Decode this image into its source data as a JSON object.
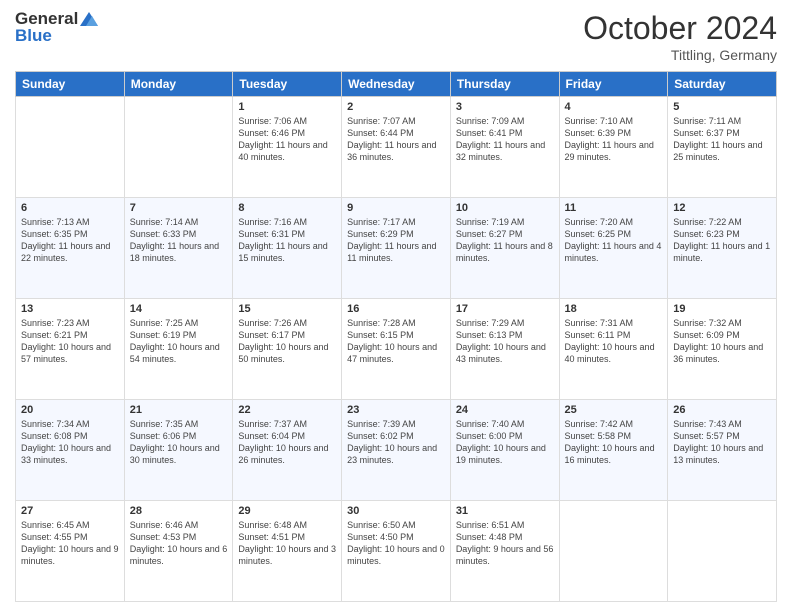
{
  "header": {
    "logo_line1": "General",
    "logo_line2": "Blue",
    "month": "October 2024",
    "location": "Tittling, Germany"
  },
  "weekdays": [
    "Sunday",
    "Monday",
    "Tuesday",
    "Wednesday",
    "Thursday",
    "Friday",
    "Saturday"
  ],
  "weeks": [
    [
      {
        "day": "",
        "sunrise": "",
        "sunset": "",
        "daylight": ""
      },
      {
        "day": "",
        "sunrise": "",
        "sunset": "",
        "daylight": ""
      },
      {
        "day": "1",
        "sunrise": "Sunrise: 7:06 AM",
        "sunset": "Sunset: 6:46 PM",
        "daylight": "Daylight: 11 hours and 40 minutes."
      },
      {
        "day": "2",
        "sunrise": "Sunrise: 7:07 AM",
        "sunset": "Sunset: 6:44 PM",
        "daylight": "Daylight: 11 hours and 36 minutes."
      },
      {
        "day": "3",
        "sunrise": "Sunrise: 7:09 AM",
        "sunset": "Sunset: 6:41 PM",
        "daylight": "Daylight: 11 hours and 32 minutes."
      },
      {
        "day": "4",
        "sunrise": "Sunrise: 7:10 AM",
        "sunset": "Sunset: 6:39 PM",
        "daylight": "Daylight: 11 hours and 29 minutes."
      },
      {
        "day": "5",
        "sunrise": "Sunrise: 7:11 AM",
        "sunset": "Sunset: 6:37 PM",
        "daylight": "Daylight: 11 hours and 25 minutes."
      }
    ],
    [
      {
        "day": "6",
        "sunrise": "Sunrise: 7:13 AM",
        "sunset": "Sunset: 6:35 PM",
        "daylight": "Daylight: 11 hours and 22 minutes."
      },
      {
        "day": "7",
        "sunrise": "Sunrise: 7:14 AM",
        "sunset": "Sunset: 6:33 PM",
        "daylight": "Daylight: 11 hours and 18 minutes."
      },
      {
        "day": "8",
        "sunrise": "Sunrise: 7:16 AM",
        "sunset": "Sunset: 6:31 PM",
        "daylight": "Daylight: 11 hours and 15 minutes."
      },
      {
        "day": "9",
        "sunrise": "Sunrise: 7:17 AM",
        "sunset": "Sunset: 6:29 PM",
        "daylight": "Daylight: 11 hours and 11 minutes."
      },
      {
        "day": "10",
        "sunrise": "Sunrise: 7:19 AM",
        "sunset": "Sunset: 6:27 PM",
        "daylight": "Daylight: 11 hours and 8 minutes."
      },
      {
        "day": "11",
        "sunrise": "Sunrise: 7:20 AM",
        "sunset": "Sunset: 6:25 PM",
        "daylight": "Daylight: 11 hours and 4 minutes."
      },
      {
        "day": "12",
        "sunrise": "Sunrise: 7:22 AM",
        "sunset": "Sunset: 6:23 PM",
        "daylight": "Daylight: 11 hours and 1 minute."
      }
    ],
    [
      {
        "day": "13",
        "sunrise": "Sunrise: 7:23 AM",
        "sunset": "Sunset: 6:21 PM",
        "daylight": "Daylight: 10 hours and 57 minutes."
      },
      {
        "day": "14",
        "sunrise": "Sunrise: 7:25 AM",
        "sunset": "Sunset: 6:19 PM",
        "daylight": "Daylight: 10 hours and 54 minutes."
      },
      {
        "day": "15",
        "sunrise": "Sunrise: 7:26 AM",
        "sunset": "Sunset: 6:17 PM",
        "daylight": "Daylight: 10 hours and 50 minutes."
      },
      {
        "day": "16",
        "sunrise": "Sunrise: 7:28 AM",
        "sunset": "Sunset: 6:15 PM",
        "daylight": "Daylight: 10 hours and 47 minutes."
      },
      {
        "day": "17",
        "sunrise": "Sunrise: 7:29 AM",
        "sunset": "Sunset: 6:13 PM",
        "daylight": "Daylight: 10 hours and 43 minutes."
      },
      {
        "day": "18",
        "sunrise": "Sunrise: 7:31 AM",
        "sunset": "Sunset: 6:11 PM",
        "daylight": "Daylight: 10 hours and 40 minutes."
      },
      {
        "day": "19",
        "sunrise": "Sunrise: 7:32 AM",
        "sunset": "Sunset: 6:09 PM",
        "daylight": "Daylight: 10 hours and 36 minutes."
      }
    ],
    [
      {
        "day": "20",
        "sunrise": "Sunrise: 7:34 AM",
        "sunset": "Sunset: 6:08 PM",
        "daylight": "Daylight: 10 hours and 33 minutes."
      },
      {
        "day": "21",
        "sunrise": "Sunrise: 7:35 AM",
        "sunset": "Sunset: 6:06 PM",
        "daylight": "Daylight: 10 hours and 30 minutes."
      },
      {
        "day": "22",
        "sunrise": "Sunrise: 7:37 AM",
        "sunset": "Sunset: 6:04 PM",
        "daylight": "Daylight: 10 hours and 26 minutes."
      },
      {
        "day": "23",
        "sunrise": "Sunrise: 7:39 AM",
        "sunset": "Sunset: 6:02 PM",
        "daylight": "Daylight: 10 hours and 23 minutes."
      },
      {
        "day": "24",
        "sunrise": "Sunrise: 7:40 AM",
        "sunset": "Sunset: 6:00 PM",
        "daylight": "Daylight: 10 hours and 19 minutes."
      },
      {
        "day": "25",
        "sunrise": "Sunrise: 7:42 AM",
        "sunset": "Sunset: 5:58 PM",
        "daylight": "Daylight: 10 hours and 16 minutes."
      },
      {
        "day": "26",
        "sunrise": "Sunrise: 7:43 AM",
        "sunset": "Sunset: 5:57 PM",
        "daylight": "Daylight: 10 hours and 13 minutes."
      }
    ],
    [
      {
        "day": "27",
        "sunrise": "Sunrise: 6:45 AM",
        "sunset": "Sunset: 4:55 PM",
        "daylight": "Daylight: 10 hours and 9 minutes."
      },
      {
        "day": "28",
        "sunrise": "Sunrise: 6:46 AM",
        "sunset": "Sunset: 4:53 PM",
        "daylight": "Daylight: 10 hours and 6 minutes."
      },
      {
        "day": "29",
        "sunrise": "Sunrise: 6:48 AM",
        "sunset": "Sunset: 4:51 PM",
        "daylight": "Daylight: 10 hours and 3 minutes."
      },
      {
        "day": "30",
        "sunrise": "Sunrise: 6:50 AM",
        "sunset": "Sunset: 4:50 PM",
        "daylight": "Daylight: 10 hours and 0 minutes."
      },
      {
        "day": "31",
        "sunrise": "Sunrise: 6:51 AM",
        "sunset": "Sunset: 4:48 PM",
        "daylight": "Daylight: 9 hours and 56 minutes."
      },
      {
        "day": "",
        "sunrise": "",
        "sunset": "",
        "daylight": ""
      },
      {
        "day": "",
        "sunrise": "",
        "sunset": "",
        "daylight": ""
      }
    ]
  ]
}
